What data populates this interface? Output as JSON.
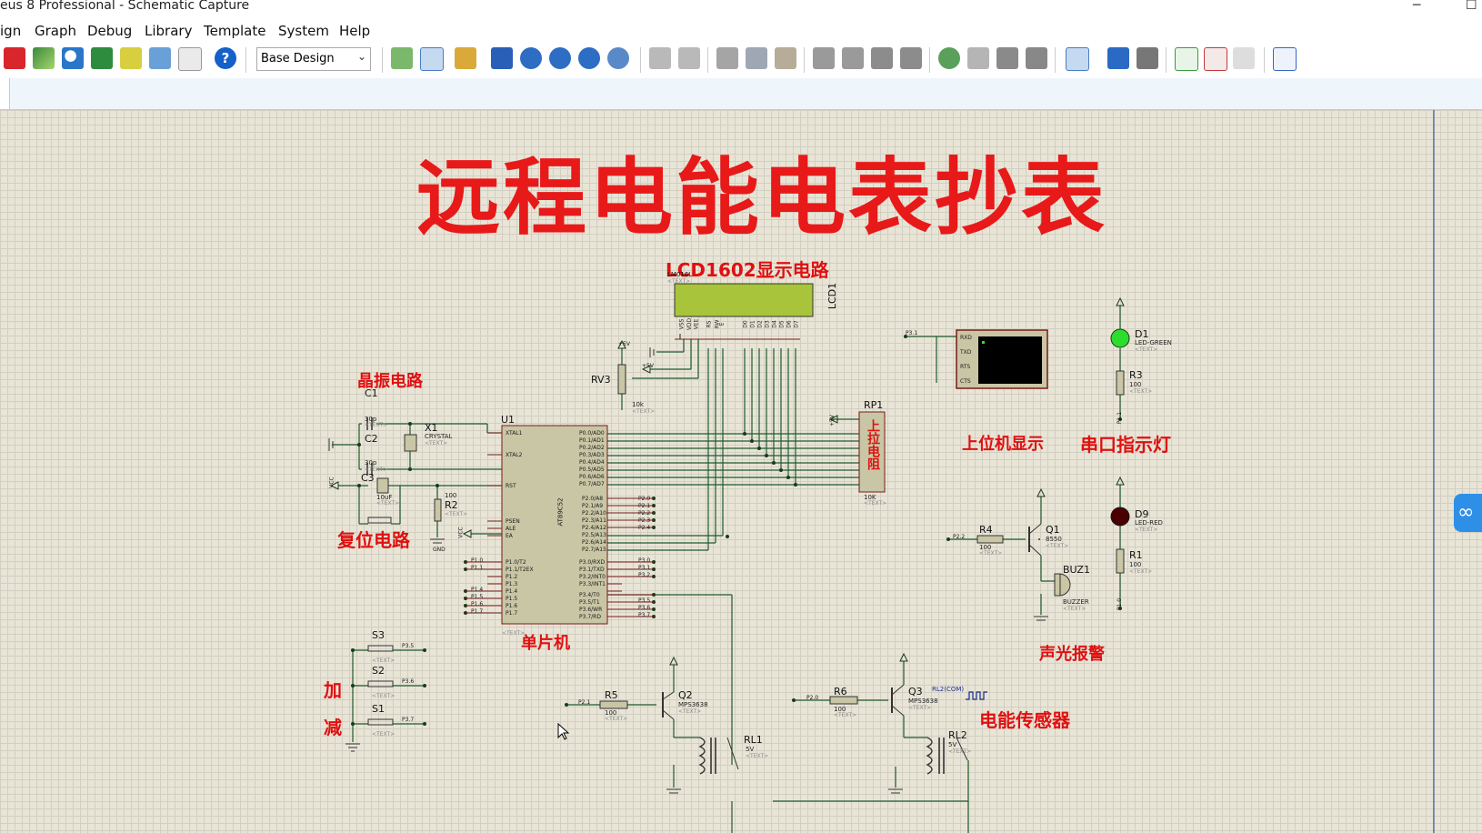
{
  "window": {
    "title": "eus 8 Professional - Schematic Capture",
    "minimize_glyph": "─",
    "maximize_glyph": "☐"
  },
  "menu": [
    "ign",
    "Graph",
    "Debug",
    "Library",
    "Template",
    "System",
    "Help"
  ],
  "toolbar": {
    "design_selector": "Base Design",
    "dropdown_glyph": "⌄",
    "help_glyph": "?"
  },
  "schematic": {
    "title": "远程电能电表抄表",
    "section_labels": {
      "lcd": "LCD1602显示电路",
      "crystal": "晶振电路",
      "reset": "复位电路",
      "mcu": "单片机",
      "pc_display": "上位机显示",
      "serial_led": "串口指示灯",
      "alarm": "声光报警",
      "sensor": "电能传感器",
      "add": "加",
      "sub": "减",
      "pullup": "上拉电阻"
    },
    "components": {
      "lcd1": {
        "ref": "LCD1",
        "model": "LM016L",
        "text": "<TEXT>"
      },
      "u1": {
        "ref": "U1",
        "model": "AT89C52",
        "text": "<TEXT>"
      },
      "x1": {
        "ref": "X1",
        "model": "CRYSTAL",
        "text": "<TEXT>"
      },
      "c1": {
        "ref": "C1",
        "value": "30p",
        "text": "<TEXT>"
      },
      "c2": {
        "ref": "C2",
        "value": "30p",
        "text": "<TEXT>"
      },
      "c3": {
        "ref": "C3",
        "value": "10uF",
        "text": "<TEXT>"
      },
      "r2": {
        "ref": "R2",
        "value": "100",
        "text": "<TEXT>"
      },
      "rv3": {
        "ref": "RV3",
        "value": "10k",
        "text": "<TEXT>"
      },
      "rp1": {
        "ref": "RP1",
        "value": "10K",
        "text": "<TEXT>"
      },
      "d1": {
        "ref": "D1",
        "model": "LED-GREEN",
        "text": "<TEXT>"
      },
      "r3": {
        "ref": "R3",
        "value": "100",
        "text": "<TEXT>"
      },
      "d9": {
        "ref": "D9",
        "model": "LED-RED",
        "text": "<TEXT>"
      },
      "r1": {
        "ref": "R1",
        "value": "100",
        "text": "<TEXT>"
      },
      "r4": {
        "ref": "R4",
        "value": "100",
        "text": "<TEXT>"
      },
      "q1": {
        "ref": "Q1",
        "model": "8550",
        "text": "<TEXT>"
      },
      "buz1": {
        "ref": "BUZ1",
        "model": "BUZZER",
        "text": "<TEXT>"
      },
      "r5": {
        "ref": "R5",
        "value": "100",
        "text": "<TEXT>"
      },
      "q2": {
        "ref": "Q2",
        "model": "MPS3638",
        "text": "<TEXT>"
      },
      "rl1": {
        "ref": "RL1",
        "value": "5V",
        "text": "<TEXT>"
      },
      "r6": {
        "ref": "R6",
        "value": "100",
        "text": "<TEXT>"
      },
      "q3": {
        "ref": "Q3",
        "model": "MPS3638",
        "text": "<TEXT>"
      },
      "rl2": {
        "ref": "RL2",
        "value": "5V",
        "text": "<TEXT>",
        "net": "RL2(COM)"
      },
      "s1": {
        "ref": "S1",
        "net": "P3.7",
        "text": "<TEXT>"
      },
      "s2": {
        "ref": "S2",
        "net": "P3.6",
        "text": "<TEXT>"
      },
      "s3": {
        "ref": "S3",
        "net": "P3.5",
        "text": "<TEXT>"
      }
    },
    "terminal": {
      "pins": [
        "RXD",
        "TXD",
        "RTS",
        "CTS"
      ],
      "net": "P3.1"
    },
    "lcd_pins": [
      "VSS",
      "VDD",
      "VEE",
      "RS",
      "RW",
      "E",
      "D0",
      "D1",
      "D2",
      "D3",
      "D4",
      "D5",
      "D6",
      "D7"
    ],
    "u1_pins_left": [
      "XTAL1",
      "XTAL2",
      "RST",
      "PSEN",
      "ALE",
      "EA",
      "P1.0/T2",
      "P1.1/T2EX",
      "P1.2",
      "P1.3",
      "P1.4",
      "P1.5",
      "P1.6",
      "P1.7"
    ],
    "u1_pins_right_p0": [
      "P0.0/AD0",
      "P0.1/AD1",
      "P0.2/AD2",
      "P0.3/AD3",
      "P0.4/AD4",
      "P0.5/AD5",
      "P0.6/AD6",
      "P0.7/AD7"
    ],
    "u1_pins_right_p2": [
      "P2.0/A8",
      "P2.1/A9",
      "P2.2/A10",
      "P2.3/A11",
      "P2.4/A12",
      "P2.5/A13",
      "P2.6/A14",
      "P2.7/A15"
    ],
    "u1_pins_right_p3": [
      "P3.0/RXD",
      "P3.1/TXD",
      "P3.2/INT0",
      "P3.3/INT1",
      "P3.4/T0",
      "P3.5/T1",
      "P3.6/WR",
      "P3.7/RD"
    ],
    "nets": {
      "vcc": "VCC",
      "gnd": "GND",
      "plus5v": "+5V",
      "p22": "P2.2",
      "p21": "P2.1",
      "p20": "P2.0",
      "p10": "P1.0",
      "p11": "P1.1",
      "p14": "P1.4",
      "p15": "P1.5",
      "p16": "P1.6",
      "p17": "P1.7",
      "p30": "P3.0",
      "p31": "P3.1",
      "p32": "P3.2",
      "p34": "P3.4",
      "p35": "P3.5",
      "p36": "P3.6",
      "p37": "P3.7",
      "p23": "P2.3",
      "p24": "P2.4",
      "p25": "P2.5",
      "p26": "P2.6"
    }
  },
  "colors": {
    "title_red": "#e81919",
    "wire": "#1f5a2c",
    "component_fill": "#c8c6a5",
    "lcd_screen": "#a8c43a",
    "led_green": "#2ddc2d",
    "led_red": "#4a0000"
  }
}
